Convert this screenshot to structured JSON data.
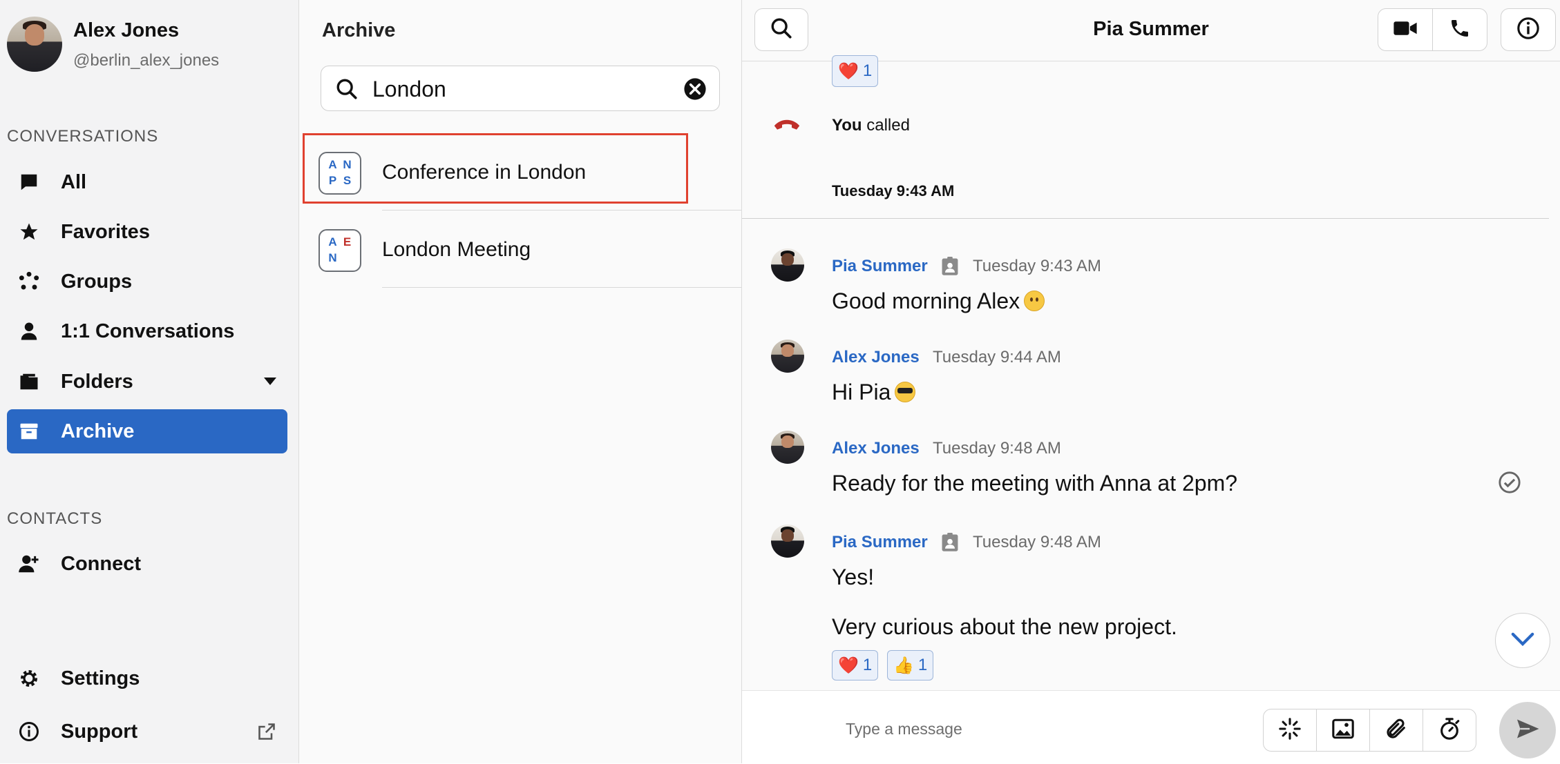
{
  "user": {
    "name": "Alex Jones",
    "handle": "@berlin_alex_jones"
  },
  "sidebar": {
    "conversations_label": "CONVERSATIONS",
    "items": [
      {
        "label": "All",
        "icon": "chat-bubble-icon"
      },
      {
        "label": "Favorites",
        "icon": "star-icon"
      },
      {
        "label": "Groups",
        "icon": "groups-icon"
      },
      {
        "label": "1:1 Conversations",
        "icon": "person-icon"
      },
      {
        "label": "Folders",
        "icon": "folder-icon"
      },
      {
        "label": "Archive",
        "icon": "archive-icon",
        "active": true
      }
    ],
    "contacts_label": "CONTACTS",
    "connect_label": "Connect",
    "settings_label": "Settings",
    "support_label": "Support"
  },
  "archive": {
    "title": "Archive",
    "search_value": "London",
    "results": [
      {
        "title": "Conference in London",
        "initials": [
          "A",
          "N",
          "P",
          "S"
        ]
      },
      {
        "title": "London Meeting",
        "initials": [
          "A",
          "E",
          "N",
          ""
        ]
      }
    ]
  },
  "chat": {
    "title": "Pia Summer",
    "top_reaction": {
      "emoji": "❤️",
      "count": "1"
    },
    "call": {
      "actor": "You",
      "text": "called"
    },
    "day_separator": "Tuesday 9:43 AM",
    "messages": [
      {
        "author": "Pia Summer",
        "time": "Tuesday 9:43 AM",
        "text": "Good morning Alex"
      },
      {
        "author": "Alex Jones",
        "time": "Tuesday 9:44 AM",
        "text": "Hi Pia"
      },
      {
        "author": "Alex Jones",
        "time": "Tuesday 9:48 AM",
        "text": "Ready for the meeting with Anna at 2pm?"
      },
      {
        "author": "Pia Summer",
        "time": "Tuesday 9:48 AM",
        "text": "Yes!",
        "text2": "Very curious about the new project."
      }
    ],
    "last_reactions": [
      {
        "emoji": "❤️",
        "count": "1"
      },
      {
        "emoji": "👍",
        "count": "1"
      }
    ],
    "composer_placeholder": "Type a message"
  },
  "colors": {
    "accent": "#2a68c4",
    "highlight": "#e0412f",
    "call_red": "#c0302a"
  }
}
